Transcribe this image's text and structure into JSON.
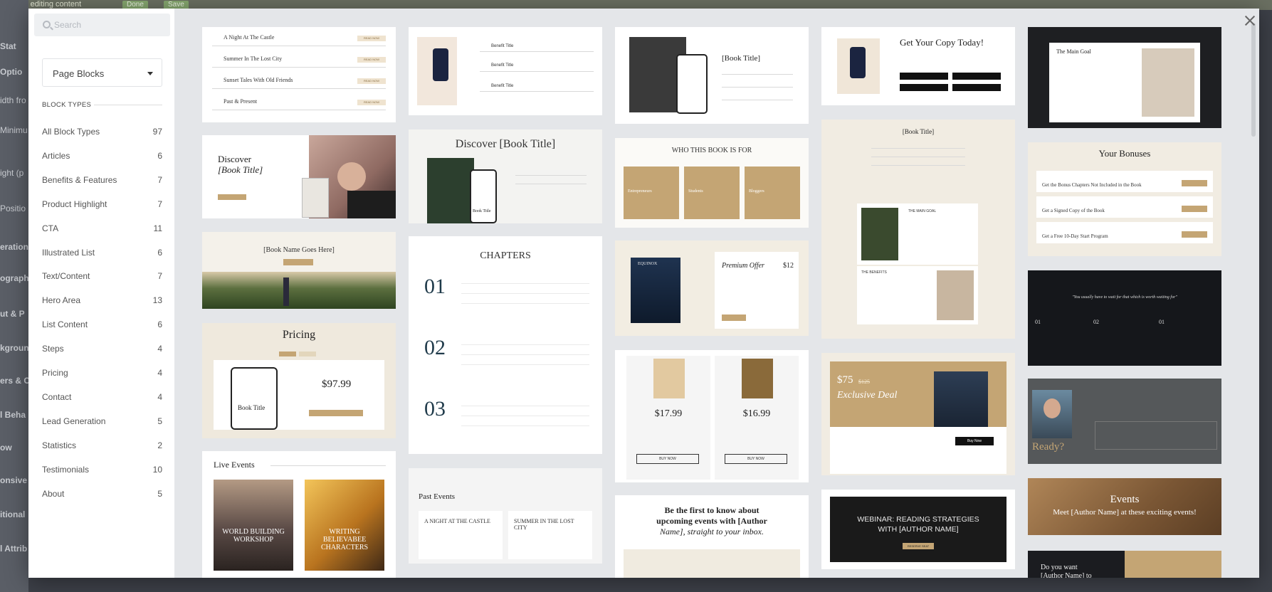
{
  "background": {
    "notice": "You are editing content",
    "btn1": "Done",
    "btn2": "Save",
    "side_labels": [
      "Stat",
      "Optio",
      "idth fro",
      "Minimu",
      "ight (p",
      "Positio",
      "erations",
      "ograph",
      "ut & P",
      "kgroun",
      "ers & C",
      "l Beha",
      "ow",
      "onsive",
      "itional",
      "l Attrib"
    ]
  },
  "sidebar": {
    "search_placeholder": "Search",
    "select_value": "Page Blocks",
    "heading": "BLOCK TYPES",
    "categories": [
      {
        "label": "All Block Types",
        "count": "97"
      },
      {
        "label": "Articles",
        "count": "6"
      },
      {
        "label": "Benefits & Features",
        "count": "7"
      },
      {
        "label": "Product Highlight",
        "count": "7"
      },
      {
        "label": "CTA",
        "count": "11"
      },
      {
        "label": "Illustrated List",
        "count": "6"
      },
      {
        "label": "Text/Content",
        "count": "7"
      },
      {
        "label": "Hero Area",
        "count": "13"
      },
      {
        "label": "List Content",
        "count": "6"
      },
      {
        "label": "Steps",
        "count": "4"
      },
      {
        "label": "Pricing",
        "count": "4"
      },
      {
        "label": "Contact",
        "count": "4"
      },
      {
        "label": "Lead Generation",
        "count": "5"
      },
      {
        "label": "Statistics",
        "count": "2"
      },
      {
        "label": "Testimonials",
        "count": "10"
      },
      {
        "label": "About",
        "count": "5"
      }
    ]
  },
  "col1": {
    "articles": [
      "A Night At The Castle",
      "Summer In The Lost City",
      "Sunset Tales With Old Friends",
      "Past & Present"
    ],
    "article_btn": "READ NOW",
    "discover_a": "Discover",
    "discover_b": "[Book Title]",
    "book_name": "[Book Name Goes Here]",
    "pricing": "Pricing",
    "book_title": "Book Title",
    "price": "$97.99",
    "live_events": "Live Events",
    "event1": "WORLD BUILDING WORKSHOP",
    "event2": "WRITING BELIEVABEE CHARACTERS"
  },
  "col2": {
    "benefit": "Benefit Title",
    "discover": "Discover [Book Title]",
    "book_title": "Book Title",
    "chapters": "CHAPTERS",
    "nums": [
      "01",
      "02",
      "03"
    ],
    "past_events": "Past Events",
    "pe1": "A NIGHT AT THE CASTLE",
    "pe2": "SUMMER IN THE LOST CITY"
  },
  "col3": {
    "book_title_br": "[Book Title]",
    "who": "WHO THIS BOOK IS FOR",
    "who_items": [
      "Entrepreneurs",
      "Students",
      "Bloggers"
    ],
    "equinox": "EQUINOX",
    "premium": "Premium Offer",
    "premium_price": "$12",
    "p1": "$17.99",
    "p2": "$16.99",
    "buy": "BUY NOW",
    "first_a": "Be the first to know about",
    "first_b": "upcoming events with [Author",
    "first_c": "Name], straight to your inbox."
  },
  "col4": {
    "copy": "Get Your Copy Today!",
    "book_title_br": "[Book Title]",
    "main_goal": "THE MAIN GOAL",
    "benefits": "THE BENEFITS",
    "deal_price": "$75",
    "deal_old": "$125",
    "deal": "Exclusive Deal",
    "buy_now": "Buy Now",
    "webinar_a": "WEBINAR: READING STRATEGIES",
    "webinar_b": "WITH [AUTHOR NAME]",
    "reserve": "RESERVE SEAT"
  },
  "col5": {
    "main_goal": "The Main Goal",
    "bonuses": "Your Bonuses",
    "bonus_items": [
      "Get the Bonus Chapters Not Included in the Book",
      "Get a Signed Copy of the Book",
      "Get a Free 10-Day Start Program"
    ],
    "quote": "\"You usually have to wait for that which is worth waiting for\"",
    "ready": "Ready?",
    "events": "Events",
    "events_sub": "Meet [Author Name] at these exciting events!",
    "do_you": "Do you want",
    "author": "[Author Name] to"
  }
}
